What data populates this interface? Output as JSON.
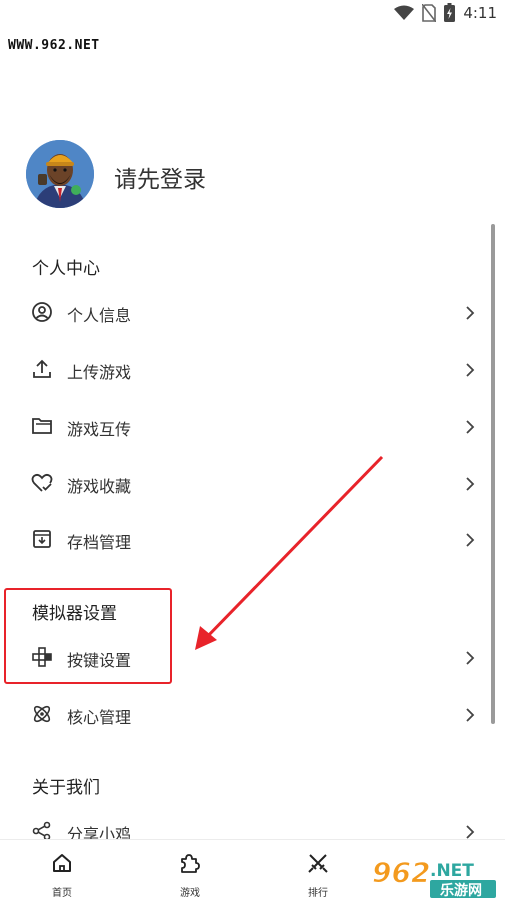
{
  "status_bar": {
    "time": "4:11"
  },
  "watermark_top": "WWW.962.NET",
  "profile": {
    "login_prompt": "请先登录"
  },
  "sections": [
    {
      "title": "个人中心",
      "items": [
        {
          "label": "个人信息",
          "icon": "user-circle-icon"
        },
        {
          "label": "上传游戏",
          "icon": "upload-icon"
        },
        {
          "label": "游戏互传",
          "icon": "folder-icon"
        },
        {
          "label": "游戏收藏",
          "icon": "heart-check-icon"
        },
        {
          "label": "存档管理",
          "icon": "archive-icon"
        }
      ]
    },
    {
      "title": "模拟器设置",
      "items": [
        {
          "label": "按键设置",
          "icon": "gamepad-dpad-icon"
        },
        {
          "label": "核心管理",
          "icon": "atom-icon"
        }
      ]
    },
    {
      "title": "关于我们",
      "items": [
        {
          "label": "分享小鸡",
          "icon": "share-icon"
        }
      ]
    }
  ],
  "bottom_nav": [
    {
      "label": "首页",
      "icon": "home-icon"
    },
    {
      "label": "游戏",
      "icon": "puzzle-icon"
    },
    {
      "label": "排行",
      "icon": "swords-icon"
    }
  ],
  "watermark_logo": {
    "main": "962",
    "suffix": ".NET",
    "sub": "乐游网"
  },
  "colors": {
    "highlight": "#e8232a",
    "arrow": "#e8232a",
    "logo_orange": "#f39a1e",
    "logo_green": "#2ea7a0"
  }
}
